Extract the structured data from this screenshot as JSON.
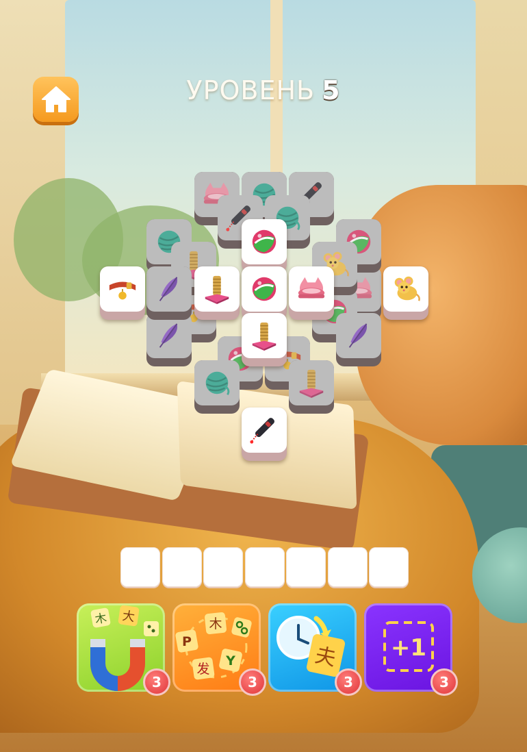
{
  "header": {
    "level_label": "УРОВЕНЬ",
    "level_number": "5"
  },
  "tiles": [
    {
      "icon": "pet-bowl-icon",
      "state": "blocked"
    },
    {
      "icon": "yarn-ball-icon",
      "state": "blocked"
    },
    {
      "icon": "laser-pointer-icon",
      "state": "blocked"
    },
    {
      "icon": "laser-pointer-icon",
      "state": "blocked"
    },
    {
      "icon": "yarn-ball-icon",
      "state": "blocked"
    },
    {
      "icon": "yarn-ball-icon",
      "state": "blocked"
    },
    {
      "icon": "cat-toy-ball-icon",
      "state": "blocked"
    },
    {
      "icon": "scratching-post-icon",
      "state": "blocked"
    },
    {
      "icon": "mouse-toy-icon",
      "state": "blocked"
    },
    {
      "icon": "feather-toy-icon",
      "state": "blocked"
    },
    {
      "icon": "pet-bowl-icon",
      "state": "blocked"
    },
    {
      "icon": "pet-collar-icon",
      "state": "blocked"
    },
    {
      "icon": "cat-toy-ball-icon",
      "state": "blocked"
    },
    {
      "icon": "feather-toy-icon",
      "state": "blocked"
    },
    {
      "icon": "feather-toy-icon",
      "state": "blocked"
    },
    {
      "icon": "cat-toy-ball-icon",
      "state": "blocked"
    },
    {
      "icon": "pet-collar-icon",
      "state": "blocked"
    },
    {
      "icon": "yarn-ball-icon",
      "state": "blocked"
    },
    {
      "icon": "scratching-post-icon",
      "state": "blocked"
    },
    {
      "icon": "cat-toy-ball-icon",
      "state": "free"
    },
    {
      "icon": "pet-collar-icon",
      "state": "free"
    },
    {
      "icon": "scratching-post-icon",
      "state": "free"
    },
    {
      "icon": "cat-toy-ball-icon",
      "state": "free"
    },
    {
      "icon": "pet-bowl-icon",
      "state": "free"
    },
    {
      "icon": "mouse-toy-icon",
      "state": "free"
    },
    {
      "icon": "scratching-post-icon",
      "state": "free"
    },
    {
      "icon": "laser-pointer-icon",
      "state": "free"
    }
  ],
  "tray": {
    "slot_count": 7
  },
  "boosters": [
    {
      "name": "magnet",
      "icon": "magnet-icon",
      "count": "3",
      "glyphs": [
        "木",
        "大"
      ]
    },
    {
      "name": "shuffle",
      "icon": "shuffle-icon",
      "count": "3",
      "glyphs": [
        "木",
        "P",
        "Y",
        "发"
      ]
    },
    {
      "name": "undo",
      "icon": "clock-undo-icon",
      "count": "3",
      "glyphs": [
        "夫"
      ]
    },
    {
      "name": "extra-slot",
      "icon": "plus-one-icon",
      "count": "3",
      "glyphs": [
        "+1"
      ]
    }
  ],
  "colors": {
    "home_button": "#f59a1f",
    "badge": "#e0353a",
    "magnet_bg": "#8cd12b",
    "shuffle_bg": "#ff7b14",
    "undo_bg": "#0f95e6",
    "extra_bg": "#6a14e0"
  }
}
